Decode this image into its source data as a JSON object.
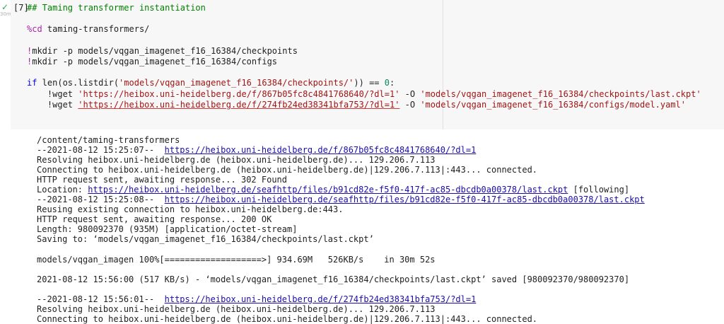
{
  "cell": {
    "status_glyph": "✓",
    "duration": "30m",
    "exec_count": "[7]"
  },
  "code": {
    "comment": "## Taming transformer instantiation",
    "cd_magic": "%cd",
    "cd_arg": " taming-transformers/",
    "mkdir1_bang": "!",
    "mkdir1_cmd": "mkdir -p models/vqgan_imagenet_f16_16384/checkpoints",
    "mkdir2_bang": "!",
    "mkdir2_cmd": "mkdir -p models/vqgan_imagenet_f16_16384/configs",
    "if_kw": "if",
    "if_fn": " len(os.listdir(",
    "if_str": "'models/vqgan_imagenet_f16_16384/checkpoints/'",
    "if_close": ")) == ",
    "if_num": "0",
    "if_colon": ":",
    "indent": "    ",
    "wget_cmd": "!wget ",
    "wget1_q1": "'",
    "wget1_url": "https://heibox.uni-heidelberg.de/f/867b05fc8c4841768640/?dl=1",
    "wget1_q2": "'",
    "wget1_flag": " -O ",
    "wget1_dest": "'models/vqgan_imagenet_f16_16384/checkpoints/last.ckpt'",
    "wget2_url": "'https://heibox.uni-heidelberg.de/f/274fb24ed38341bfa753/?dl=1'",
    "wget2_flag": " -O ",
    "wget2_dest": "'models/vqgan_imagenet_f16_16384/configs/model.yaml'"
  },
  "output": {
    "cwd": "/content/taming-transformers",
    "t1_prefix": "--2021-08-12 15:25:07--  ",
    "t1_url": "https://heibox.uni-heidelberg.de/f/867b05fc8c4841768640/?dl=1",
    "resolving1": "Resolving heibox.uni-heidelberg.de (heibox.uni-heidelberg.de)... 129.206.7.113",
    "connecting1": "Connecting to heibox.uni-heidelberg.de (heibox.uni-heidelberg.de)|129.206.7.113|:443... connected.",
    "http302": "HTTP request sent, awaiting response... 302 Found",
    "location_prefix": "Location: ",
    "location_url": "https://heibox.uni-heidelberg.de/seafhttp/files/b91cd82e-f5f0-417f-ac85-dbcdb0a00378/last.ckpt",
    "location_suffix": " [following]",
    "t2_prefix": "--2021-08-12 15:25:08--  ",
    "t2_url": "https://heibox.uni-heidelberg.de/seafhttp/files/b91cd82e-f5f0-417f-ac85-dbcdb0a00378/last.ckpt",
    "reusing": "Reusing existing connection to heibox.uni-heidelberg.de:443.",
    "http200": "HTTP request sent, awaiting response... 200 OK",
    "length": "Length: 980092370 (935M) [application/octet-stream]",
    "saving": "Saving to: ‘models/vqgan_imagenet_f16_16384/checkpoints/last.ckpt’",
    "progress": "models/vqgan_imagen 100%[===================>] 934.69M   526KB/s    in 30m 52s",
    "saved": "2021-08-12 15:56:00 (517 KB/s) - ‘models/vqgan_imagenet_f16_16384/checkpoints/last.ckpt’ saved [980092370/980092370]",
    "t3_prefix": "--2021-08-12 15:56:01--  ",
    "t3_url": "https://heibox.uni-heidelberg.de/f/274fb24ed38341bfa753/?dl=1",
    "resolving2": "Resolving heibox.uni-heidelberg.de (heibox.uni-heidelberg.de)... 129.206.7.113",
    "connecting2": "Connecting to heibox.uni-heidelberg.de (heibox.uni-heidelberg.de)|129.206.7.113|:443... connected."
  }
}
